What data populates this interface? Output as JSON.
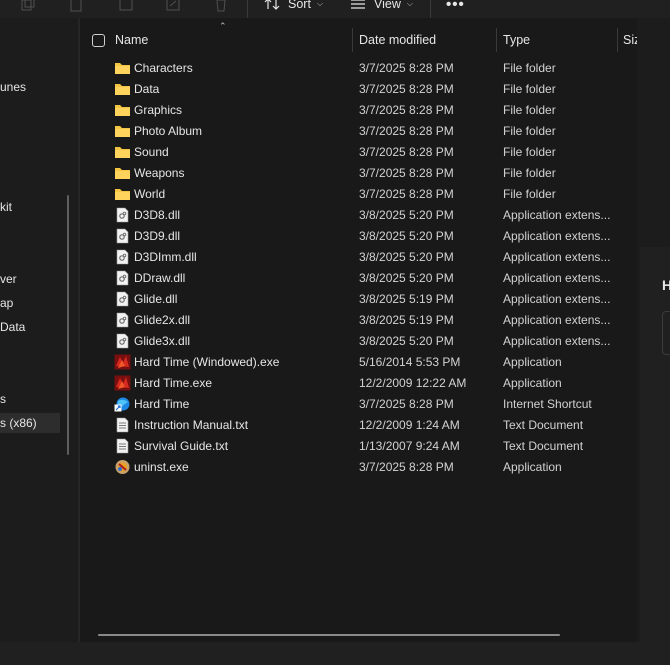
{
  "toolbar": {
    "sort_label": "Sort",
    "view_label": "View",
    "more_label": "•••"
  },
  "nav": {
    "items": [
      {
        "label": "unes"
      },
      {
        "label": "kit"
      },
      {
        "label": "ver"
      },
      {
        "label": "ap"
      },
      {
        "label": " Data"
      },
      {
        "label": "s"
      },
      {
        "label": "s (x86)",
        "selected": true
      }
    ]
  },
  "columns": {
    "name": "Name",
    "date": "Date modified",
    "type": "Type",
    "size": "Size"
  },
  "files": [
    {
      "name": "Characters",
      "date": "3/7/2025 8:28 PM",
      "type": "File folder",
      "icon": "folder-icon"
    },
    {
      "name": "Data",
      "date": "3/7/2025 8:28 PM",
      "type": "File folder",
      "icon": "folder-icon"
    },
    {
      "name": "Graphics",
      "date": "3/7/2025 8:28 PM",
      "type": "File folder",
      "icon": "folder-icon"
    },
    {
      "name": "Photo Album",
      "date": "3/7/2025 8:28 PM",
      "type": "File folder",
      "icon": "folder-icon"
    },
    {
      "name": "Sound",
      "date": "3/7/2025 8:28 PM",
      "type": "File folder",
      "icon": "folder-icon"
    },
    {
      "name": "Weapons",
      "date": "3/7/2025 8:28 PM",
      "type": "File folder",
      "icon": "folder-icon"
    },
    {
      "name": "World",
      "date": "3/7/2025 8:28 PM",
      "type": "File folder",
      "icon": "folder-icon"
    },
    {
      "name": "D3D8.dll",
      "date": "3/8/2025 5:20 PM",
      "type": "Application extens...",
      "icon": "dll-file-icon"
    },
    {
      "name": "D3D9.dll",
      "date": "3/8/2025 5:20 PM",
      "type": "Application extens...",
      "icon": "dll-file-icon"
    },
    {
      "name": "D3DImm.dll",
      "date": "3/8/2025 5:20 PM",
      "type": "Application extens...",
      "icon": "dll-file-icon"
    },
    {
      "name": "DDraw.dll",
      "date": "3/8/2025 5:20 PM",
      "type": "Application extens...",
      "icon": "dll-file-icon"
    },
    {
      "name": "Glide.dll",
      "date": "3/8/2025 5:19 PM",
      "type": "Application extens...",
      "icon": "dll-file-icon"
    },
    {
      "name": "Glide2x.dll",
      "date": "3/8/2025 5:19 PM",
      "type": "Application extens...",
      "icon": "dll-file-icon"
    },
    {
      "name": "Glide3x.dll",
      "date": "3/8/2025 5:20 PM",
      "type": "Application extens...",
      "icon": "dll-file-icon"
    },
    {
      "name": "Hard Time (Windowed).exe",
      "date": "5/16/2014 5:53 PM",
      "type": "Application",
      "icon": "game-exe-icon"
    },
    {
      "name": "Hard Time.exe",
      "date": "12/2/2009 12:22 AM",
      "type": "Application",
      "icon": "game-exe-icon"
    },
    {
      "name": "Hard Time",
      "date": "3/7/2025 8:28 PM",
      "type": "Internet Shortcut",
      "icon": "internet-shortcut-icon"
    },
    {
      "name": "Instruction Manual.txt",
      "date": "12/2/2009 1:24 AM",
      "type": "Text Document",
      "icon": "text-file-icon"
    },
    {
      "name": "Survival Guide.txt",
      "date": "1/13/2007 9:24 AM",
      "type": "Text Document",
      "icon": "text-file-icon"
    },
    {
      "name": "uninst.exe",
      "date": "3/7/2025 8:28 PM",
      "type": "Application",
      "icon": "uninstaller-icon"
    }
  ],
  "details": {
    "title": "H"
  },
  "colors": {
    "background": "#191919",
    "folder": "#f4c542",
    "text": "#e6e6e6"
  }
}
